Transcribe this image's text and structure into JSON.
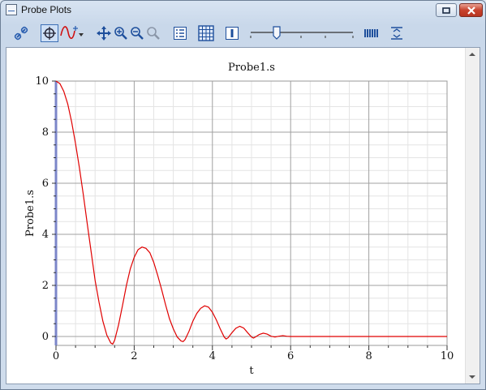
{
  "window": {
    "title": "Probe Plots"
  },
  "toolbar": {
    "items": [
      "link-icon",
      "crosshair-icon",
      "add-curve-icon",
      "pan-icon",
      "zoom-in-icon",
      "zoom-out-icon",
      "zoom-fit-icon",
      "legend-icon",
      "grid-icon",
      "cursor-icon",
      "time-slider",
      "bars-icon",
      "fit-vertical-icon"
    ]
  },
  "colors": {
    "series": "#e00000",
    "axis_accent": "#7b86c9",
    "grid_major": "#a0a0a0",
    "grid_minor": "#e4e4e4"
  },
  "chart_data": {
    "type": "line",
    "title": "Probe1.s",
    "xlabel": "t",
    "ylabel": "Probe1.s",
    "xlim": [
      0,
      10
    ],
    "ylim": [
      -0.35,
      10
    ],
    "xticks": [
      "0",
      "2",
      "4",
      "6",
      "8",
      "10"
    ],
    "yticks": [
      "0",
      "2",
      "4",
      "6",
      "8",
      "10"
    ],
    "grid": true,
    "series": [
      {
        "x": [
          0,
          0.1,
          0.2,
          0.3,
          0.4,
          0.5,
          0.6,
          0.7,
          0.8,
          0.9,
          1.0,
          1.1,
          1.2,
          1.3,
          1.4,
          1.45,
          1.5,
          1.6,
          1.7,
          1.8,
          1.9,
          2.0,
          2.1,
          2.2,
          2.3,
          2.4,
          2.5,
          2.6,
          2.7,
          2.8,
          2.9,
          3.0,
          3.1,
          3.2,
          3.25,
          3.3,
          3.4,
          3.5,
          3.6,
          3.7,
          3.8,
          3.9,
          4.0,
          4.1,
          4.2,
          4.3,
          4.35,
          4.4,
          4.5,
          4.6,
          4.7,
          4.8,
          4.9,
          5.0,
          5.05,
          5.1,
          5.2,
          5.3,
          5.4,
          5.5,
          5.6,
          5.7,
          5.8,
          5.9,
          6.0,
          6.5,
          7.0,
          8.0,
          9.0,
          10.0
        ],
        "y": [
          10.0,
          9.9,
          9.6,
          9.1,
          8.4,
          7.55,
          6.6,
          5.55,
          4.4,
          3.3,
          2.2,
          1.35,
          0.6,
          0.05,
          -0.25,
          -0.3,
          -0.15,
          0.45,
          1.2,
          2.0,
          2.65,
          3.1,
          3.4,
          3.5,
          3.45,
          3.28,
          2.9,
          2.4,
          1.85,
          1.25,
          0.7,
          0.3,
          -0.02,
          -0.18,
          -0.2,
          -0.12,
          0.2,
          0.6,
          0.9,
          1.1,
          1.2,
          1.15,
          0.95,
          0.65,
          0.3,
          -0.02,
          -0.1,
          -0.05,
          0.15,
          0.32,
          0.4,
          0.33,
          0.15,
          -0.02,
          -0.06,
          -0.02,
          0.08,
          0.13,
          0.09,
          0.01,
          -0.02,
          0.01,
          0.03,
          0.01,
          0.0,
          0.0,
          0.0,
          0.0,
          0.0,
          0.0
        ]
      }
    ]
  }
}
